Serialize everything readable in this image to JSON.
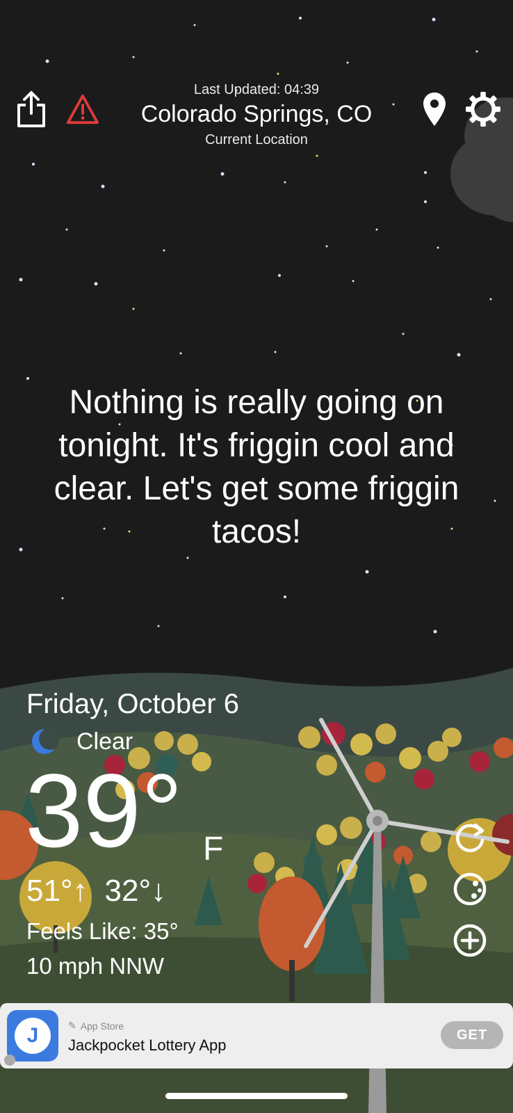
{
  "header": {
    "last_updated": "Last Updated: 04:39",
    "location": "Colorado Springs, CO",
    "location_sub": "Current Location",
    "icons": [
      "share-icon",
      "alert-icon",
      "location-pin-icon",
      "gear-icon"
    ]
  },
  "message": "Nothing is really going on tonight. It's friggin cool and clear. Let's get some friggin tacos!",
  "weather": {
    "date": "Friday, October 6",
    "condition": "Clear",
    "condition_icon": "moon-icon",
    "temp": "39°",
    "unit": "F",
    "high": "51°",
    "low": "32°",
    "feels_like": "Feels Like: 35°",
    "wind": "10 mph NNW"
  },
  "side_buttons": [
    "refresh-icon",
    "radar-icon",
    "add-icon"
  ],
  "ad": {
    "store": "App Store",
    "title": "Jackpocket Lottery App",
    "icon_letter": "J",
    "cta": "GET"
  },
  "colors": {
    "sky": "#1b1b1c",
    "alert": "#e03b3b",
    "moon": "#3b7be0",
    "hill": "#3c4a46",
    "grass": "#4b5a3e"
  }
}
